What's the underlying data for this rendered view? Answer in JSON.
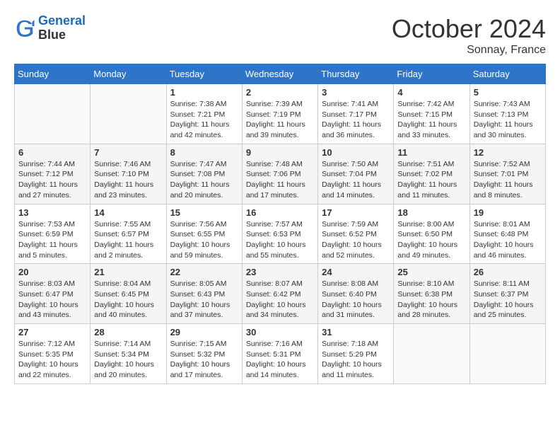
{
  "header": {
    "logo_line1": "General",
    "logo_line2": "Blue",
    "month": "October 2024",
    "location": "Sonnay, France"
  },
  "days_of_week": [
    "Sunday",
    "Monday",
    "Tuesday",
    "Wednesday",
    "Thursday",
    "Friday",
    "Saturday"
  ],
  "weeks": [
    [
      {
        "day": "",
        "info": ""
      },
      {
        "day": "",
        "info": ""
      },
      {
        "day": "1",
        "info": "Sunrise: 7:38 AM\nSunset: 7:21 PM\nDaylight: 11 hours and 42 minutes."
      },
      {
        "day": "2",
        "info": "Sunrise: 7:39 AM\nSunset: 7:19 PM\nDaylight: 11 hours and 39 minutes."
      },
      {
        "day": "3",
        "info": "Sunrise: 7:41 AM\nSunset: 7:17 PM\nDaylight: 11 hours and 36 minutes."
      },
      {
        "day": "4",
        "info": "Sunrise: 7:42 AM\nSunset: 7:15 PM\nDaylight: 11 hours and 33 minutes."
      },
      {
        "day": "5",
        "info": "Sunrise: 7:43 AM\nSunset: 7:13 PM\nDaylight: 11 hours and 30 minutes."
      }
    ],
    [
      {
        "day": "6",
        "info": "Sunrise: 7:44 AM\nSunset: 7:12 PM\nDaylight: 11 hours and 27 minutes."
      },
      {
        "day": "7",
        "info": "Sunrise: 7:46 AM\nSunset: 7:10 PM\nDaylight: 11 hours and 23 minutes."
      },
      {
        "day": "8",
        "info": "Sunrise: 7:47 AM\nSunset: 7:08 PM\nDaylight: 11 hours and 20 minutes."
      },
      {
        "day": "9",
        "info": "Sunrise: 7:48 AM\nSunset: 7:06 PM\nDaylight: 11 hours and 17 minutes."
      },
      {
        "day": "10",
        "info": "Sunrise: 7:50 AM\nSunset: 7:04 PM\nDaylight: 11 hours and 14 minutes."
      },
      {
        "day": "11",
        "info": "Sunrise: 7:51 AM\nSunset: 7:02 PM\nDaylight: 11 hours and 11 minutes."
      },
      {
        "day": "12",
        "info": "Sunrise: 7:52 AM\nSunset: 7:01 PM\nDaylight: 11 hours and 8 minutes."
      }
    ],
    [
      {
        "day": "13",
        "info": "Sunrise: 7:53 AM\nSunset: 6:59 PM\nDaylight: 11 hours and 5 minutes."
      },
      {
        "day": "14",
        "info": "Sunrise: 7:55 AM\nSunset: 6:57 PM\nDaylight: 11 hours and 2 minutes."
      },
      {
        "day": "15",
        "info": "Sunrise: 7:56 AM\nSunset: 6:55 PM\nDaylight: 10 hours and 59 minutes."
      },
      {
        "day": "16",
        "info": "Sunrise: 7:57 AM\nSunset: 6:53 PM\nDaylight: 10 hours and 55 minutes."
      },
      {
        "day": "17",
        "info": "Sunrise: 7:59 AM\nSunset: 6:52 PM\nDaylight: 10 hours and 52 minutes."
      },
      {
        "day": "18",
        "info": "Sunrise: 8:00 AM\nSunset: 6:50 PM\nDaylight: 10 hours and 49 minutes."
      },
      {
        "day": "19",
        "info": "Sunrise: 8:01 AM\nSunset: 6:48 PM\nDaylight: 10 hours and 46 minutes."
      }
    ],
    [
      {
        "day": "20",
        "info": "Sunrise: 8:03 AM\nSunset: 6:47 PM\nDaylight: 10 hours and 43 minutes."
      },
      {
        "day": "21",
        "info": "Sunrise: 8:04 AM\nSunset: 6:45 PM\nDaylight: 10 hours and 40 minutes."
      },
      {
        "day": "22",
        "info": "Sunrise: 8:05 AM\nSunset: 6:43 PM\nDaylight: 10 hours and 37 minutes."
      },
      {
        "day": "23",
        "info": "Sunrise: 8:07 AM\nSunset: 6:42 PM\nDaylight: 10 hours and 34 minutes."
      },
      {
        "day": "24",
        "info": "Sunrise: 8:08 AM\nSunset: 6:40 PM\nDaylight: 10 hours and 31 minutes."
      },
      {
        "day": "25",
        "info": "Sunrise: 8:10 AM\nSunset: 6:38 PM\nDaylight: 10 hours and 28 minutes."
      },
      {
        "day": "26",
        "info": "Sunrise: 8:11 AM\nSunset: 6:37 PM\nDaylight: 10 hours and 25 minutes."
      }
    ],
    [
      {
        "day": "27",
        "info": "Sunrise: 7:12 AM\nSunset: 5:35 PM\nDaylight: 10 hours and 22 minutes."
      },
      {
        "day": "28",
        "info": "Sunrise: 7:14 AM\nSunset: 5:34 PM\nDaylight: 10 hours and 20 minutes."
      },
      {
        "day": "29",
        "info": "Sunrise: 7:15 AM\nSunset: 5:32 PM\nDaylight: 10 hours and 17 minutes."
      },
      {
        "day": "30",
        "info": "Sunrise: 7:16 AM\nSunset: 5:31 PM\nDaylight: 10 hours and 14 minutes."
      },
      {
        "day": "31",
        "info": "Sunrise: 7:18 AM\nSunset: 5:29 PM\nDaylight: 10 hours and 11 minutes."
      },
      {
        "day": "",
        "info": ""
      },
      {
        "day": "",
        "info": ""
      }
    ]
  ]
}
